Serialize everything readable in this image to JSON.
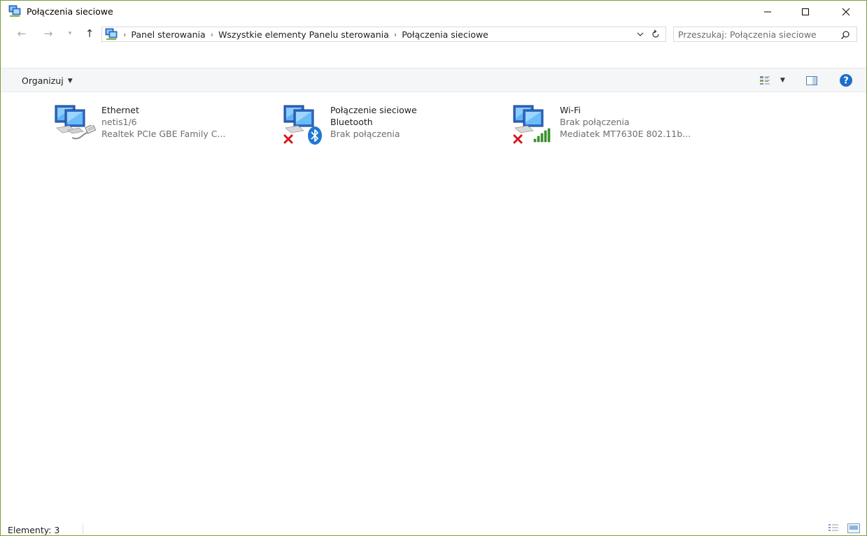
{
  "window": {
    "title": "Połączenia sieciowe",
    "minimize_label": "—",
    "maximize_label": "☐",
    "close_label": "✕"
  },
  "nav": {
    "back_label": "←",
    "forward_label": "→",
    "recent_label": "▾",
    "up_label": "↑",
    "breadcrumbs": [
      "Panel sterowania",
      "Wszystkie elementy Panelu sterowania",
      "Połączenia sieciowe"
    ],
    "search_placeholder": "Przeszukaj: Połączenia sieciowe"
  },
  "toolbar": {
    "organize_label": "Organizuj",
    "organize_caret": "▼",
    "view_caret": "▼"
  },
  "connections": [
    {
      "name": "Ethernet",
      "line2": "netis1/6",
      "line3": "Realtek PCIe GBE Family C...",
      "icon": "ethernet-cable-icon",
      "status_icon": "none"
    },
    {
      "name": "Połączenie sieciowe",
      "name2": "Bluetooth",
      "line3": "Brak połączenia",
      "icon": "bluetooth-icon",
      "status_icon": "red-x-icon"
    },
    {
      "name": "Wi-Fi",
      "line2": "Brak połączenia",
      "line3": "Mediatek MT7630E 802.11b...",
      "icon": "wifi-signal-icon",
      "status_icon": "red-x-icon"
    }
  ],
  "status": {
    "count_text": "Elementy: 3"
  },
  "colors": {
    "window_border": "#7a9f3a",
    "toolbar_bg": "#f5f6f7",
    "help_blue": "#1e6fc9",
    "error_red": "#d7161a",
    "signal_green": "#3b9b2b",
    "bluetooth_blue": "#1e78d2"
  }
}
